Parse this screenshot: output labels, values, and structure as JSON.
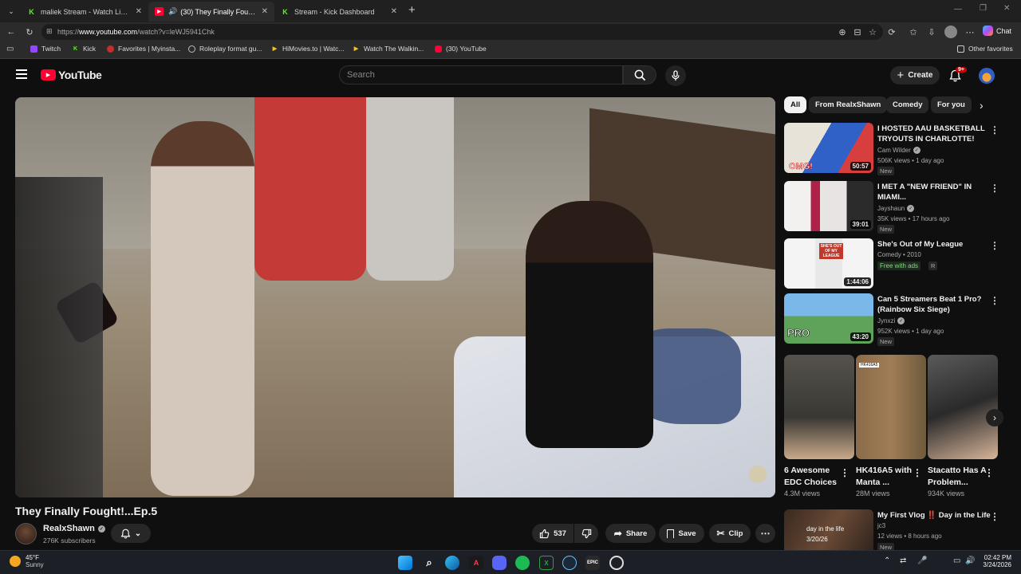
{
  "browser": {
    "tabs": [
      {
        "title": "maliek Stream - Watch Live on Kic",
        "favicon": "kick-icon",
        "color": "#53fc18"
      },
      {
        "title": "(30) They Finally Fought!...Ep.5",
        "favicon": "youtube-icon",
        "color": "#ff0033"
      },
      {
        "title": "Stream - Kick Dashboard",
        "favicon": "kick-icon",
        "color": "#53fc18"
      }
    ],
    "new_tab": "+",
    "url_prefix": "https://",
    "url_host": "www.youtube.com",
    "url_path": "/watch?v=leWJ5941Chk",
    "chat_label": "Chat",
    "bookmarks": [
      {
        "label": "Twitch",
        "color": "#9146ff"
      },
      {
        "label": "Kick",
        "color": "#53fc18"
      },
      {
        "label": "Favorites | Myinsta...",
        "color": "#c4302b"
      },
      {
        "label": "Roleplay format gu...",
        "color": "#888888"
      },
      {
        "label": "HiMovies.to | Watc...",
        "color": "#f5c518"
      },
      {
        "label": "Watch The Walkin...",
        "color": "#f5c518"
      },
      {
        "label": "(30) YouTube",
        "color": "#ff0033"
      }
    ],
    "other_favorites": "Other favorites"
  },
  "youtube": {
    "logo_text": "YouTube",
    "search_placeholder": "Search",
    "create_label": "Create",
    "notif_count": "9+",
    "video_title": "They Finally Fought!...Ep.5",
    "channel_name": "RealxShawn",
    "subscribers": "276K subscribers",
    "likes": "537",
    "share_label": "Share",
    "save_label": "Save",
    "clip_label": "Clip",
    "chips": [
      "All",
      "From RealxShawn",
      "Comedy",
      "For you"
    ],
    "recommendations": [
      {
        "title": "I HOSTED AAU BASKETBALL TRYOUTS IN CHARLOTTE!",
        "channel": "Cam Wilder",
        "verified": true,
        "meta": "506K views • 1 day ago",
        "badge": "New",
        "duration": "50:57",
        "thumb_text": "OMG!"
      },
      {
        "title": "I MET A \"NEW FRIEND\" IN MIAMI...",
        "channel": "Jayshaun",
        "verified": true,
        "meta": "35K views • 17 hours ago",
        "badge": "New",
        "duration": "39:01",
        "thumb_text": ""
      },
      {
        "title": "She's Out of My League",
        "channel": "Comedy • 2010",
        "verified": false,
        "meta": "Free with ads",
        "badge": "R",
        "duration": "1:44:06",
        "thumb_text": "SHE'S OUT OF MY LEAGUE"
      },
      {
        "title": "Can 5 Streamers Beat 1 Pro? (Rainbow Six Siege)",
        "channel": "Jynxzi",
        "verified": true,
        "meta": "952K views • 1 day ago",
        "badge": "New",
        "duration": "43:20",
        "thumb_text": "PRO"
      },
      {
        "title": "My First Vlog ‼️ Day in the Life",
        "channel": "jc3",
        "verified": false,
        "meta": "12 views • 8 hours ago",
        "badge": "New",
        "duration": "",
        "thumb_text": "day in the life 3/20/26"
      }
    ],
    "shorts": [
      {
        "title": "6 Awesome EDC Choices",
        "views": "4.3M views"
      },
      {
        "title": "HK416A5 with Manta ...",
        "views": "28M views",
        "thumb_label": "HK416A5"
      },
      {
        "title": "Stacatto Has A Problem...",
        "views": "934K views"
      }
    ]
  },
  "taskbar": {
    "weather_temp": "45°F",
    "weather_desc": "Sunny",
    "time": "02:42 PM",
    "date": "3/24/2026"
  }
}
